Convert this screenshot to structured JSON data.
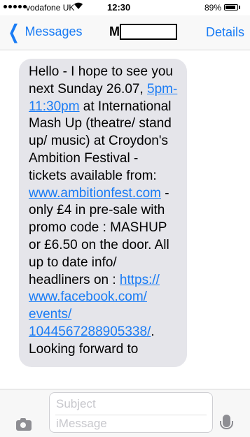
{
  "status_bar": {
    "carrier": "vodafone UK",
    "wifi_icon": "wifi-icon",
    "time": "12:30",
    "battery_percent": "89%",
    "battery_level": 0.89
  },
  "nav": {
    "back_label": "Messages",
    "contact_initial": "M",
    "details_label": "Details"
  },
  "message": {
    "part1": "Hello - I hope to see you next Sunday 26.07, ",
    "time_link": "5pm-11:30pm",
    "part2": " at International Mash Up (theatre/ stand up/ music) at Croydon's Ambition Festival - tickets available from: ",
    "site_link": "www.ambitionfest.com",
    "part3": " - only £4 in pre-sale with promo code : MASHUP or £6.50 on the door. All up to date info/ headliners on : ",
    "fb_link": "https:// www.facebook.com/ events/ 1044567288905338/",
    "part4": ". Looking forward to"
  },
  "input": {
    "subject_placeholder": "Subject",
    "message_placeholder": "iMessage"
  },
  "colors": {
    "accent": "#1a7cf5",
    "bubble": "#e5e5ea"
  }
}
